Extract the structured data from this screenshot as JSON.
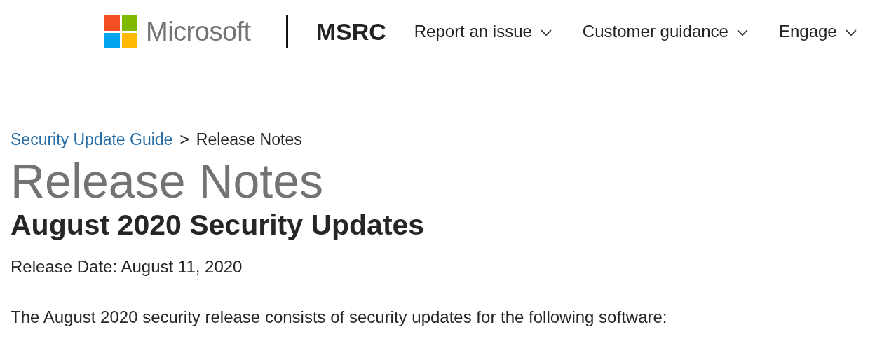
{
  "header": {
    "brand": "Microsoft",
    "site": "MSRC",
    "nav": [
      {
        "label": "Report an issue"
      },
      {
        "label": "Customer guidance"
      },
      {
        "label": "Engage"
      }
    ]
  },
  "breadcrumb": {
    "link": "Security Update Guide",
    "separator": ">",
    "current": "Release Notes"
  },
  "title": "Release Notes",
  "subtitle": "August 2020 Security Updates",
  "release_date": "Release Date: August 11, 2020",
  "intro": "The August 2020 security release consists of security updates for the following software:"
}
